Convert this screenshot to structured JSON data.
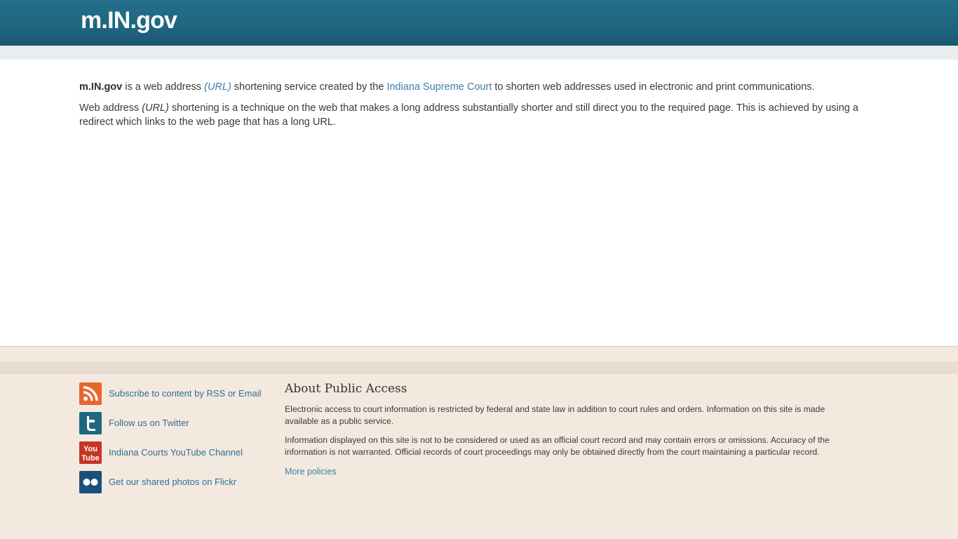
{
  "header": {
    "site_title": "m.IN.gov"
  },
  "main": {
    "intro": {
      "site_name": "m.IN.gov",
      "text1": " is a web address ",
      "url_term": "(URL)",
      "text2": " shortening service created by the ",
      "court_link": "Indiana Supreme Court",
      "text3": " to shorten web addresses used in electronic and print communications."
    },
    "explain": {
      "text1": "Web address ",
      "url_term": "(URL)",
      "text2": " shortening is a technique on the web that makes a long address substantially shorter and still direct you to the required page. This is achieved by using a redirect which links to the web page that has a long URL."
    }
  },
  "footer": {
    "social": [
      {
        "label": "Subscribe to content by RSS or Email",
        "icon": "rss-icon",
        "color": "#e8662e"
      },
      {
        "label": "Follow us on Twitter",
        "icon": "twitter-icon",
        "color": "#1f6680"
      },
      {
        "label": "Indiana Courts YouTube Channel",
        "icon": "youtube-icon",
        "color": "#c63626",
        "icon_text_1": "You",
        "icon_text_2": "Tube"
      },
      {
        "label": "Get our shared photos on Flickr",
        "icon": "flickr-icon",
        "color": "#1b4f7c"
      }
    ],
    "about": {
      "title": "About Public Access",
      "para1": "Electronic access to court information is restricted by federal and state law in addition to court rules and orders. Information on this site is made available as a public service.",
      "para2": "Information displayed on this site is not to be considered or used as an official court record and may contain errors or omissions. Accuracy of the information is not warranted. Official records of court proceedings may only be obtained directly from the court maintaining a particular record.",
      "more_link": "More policies"
    }
  },
  "colors": {
    "header_bg": "#1f6680",
    "link": "#3c7fa8",
    "footer_bg": "#f3e9df"
  }
}
